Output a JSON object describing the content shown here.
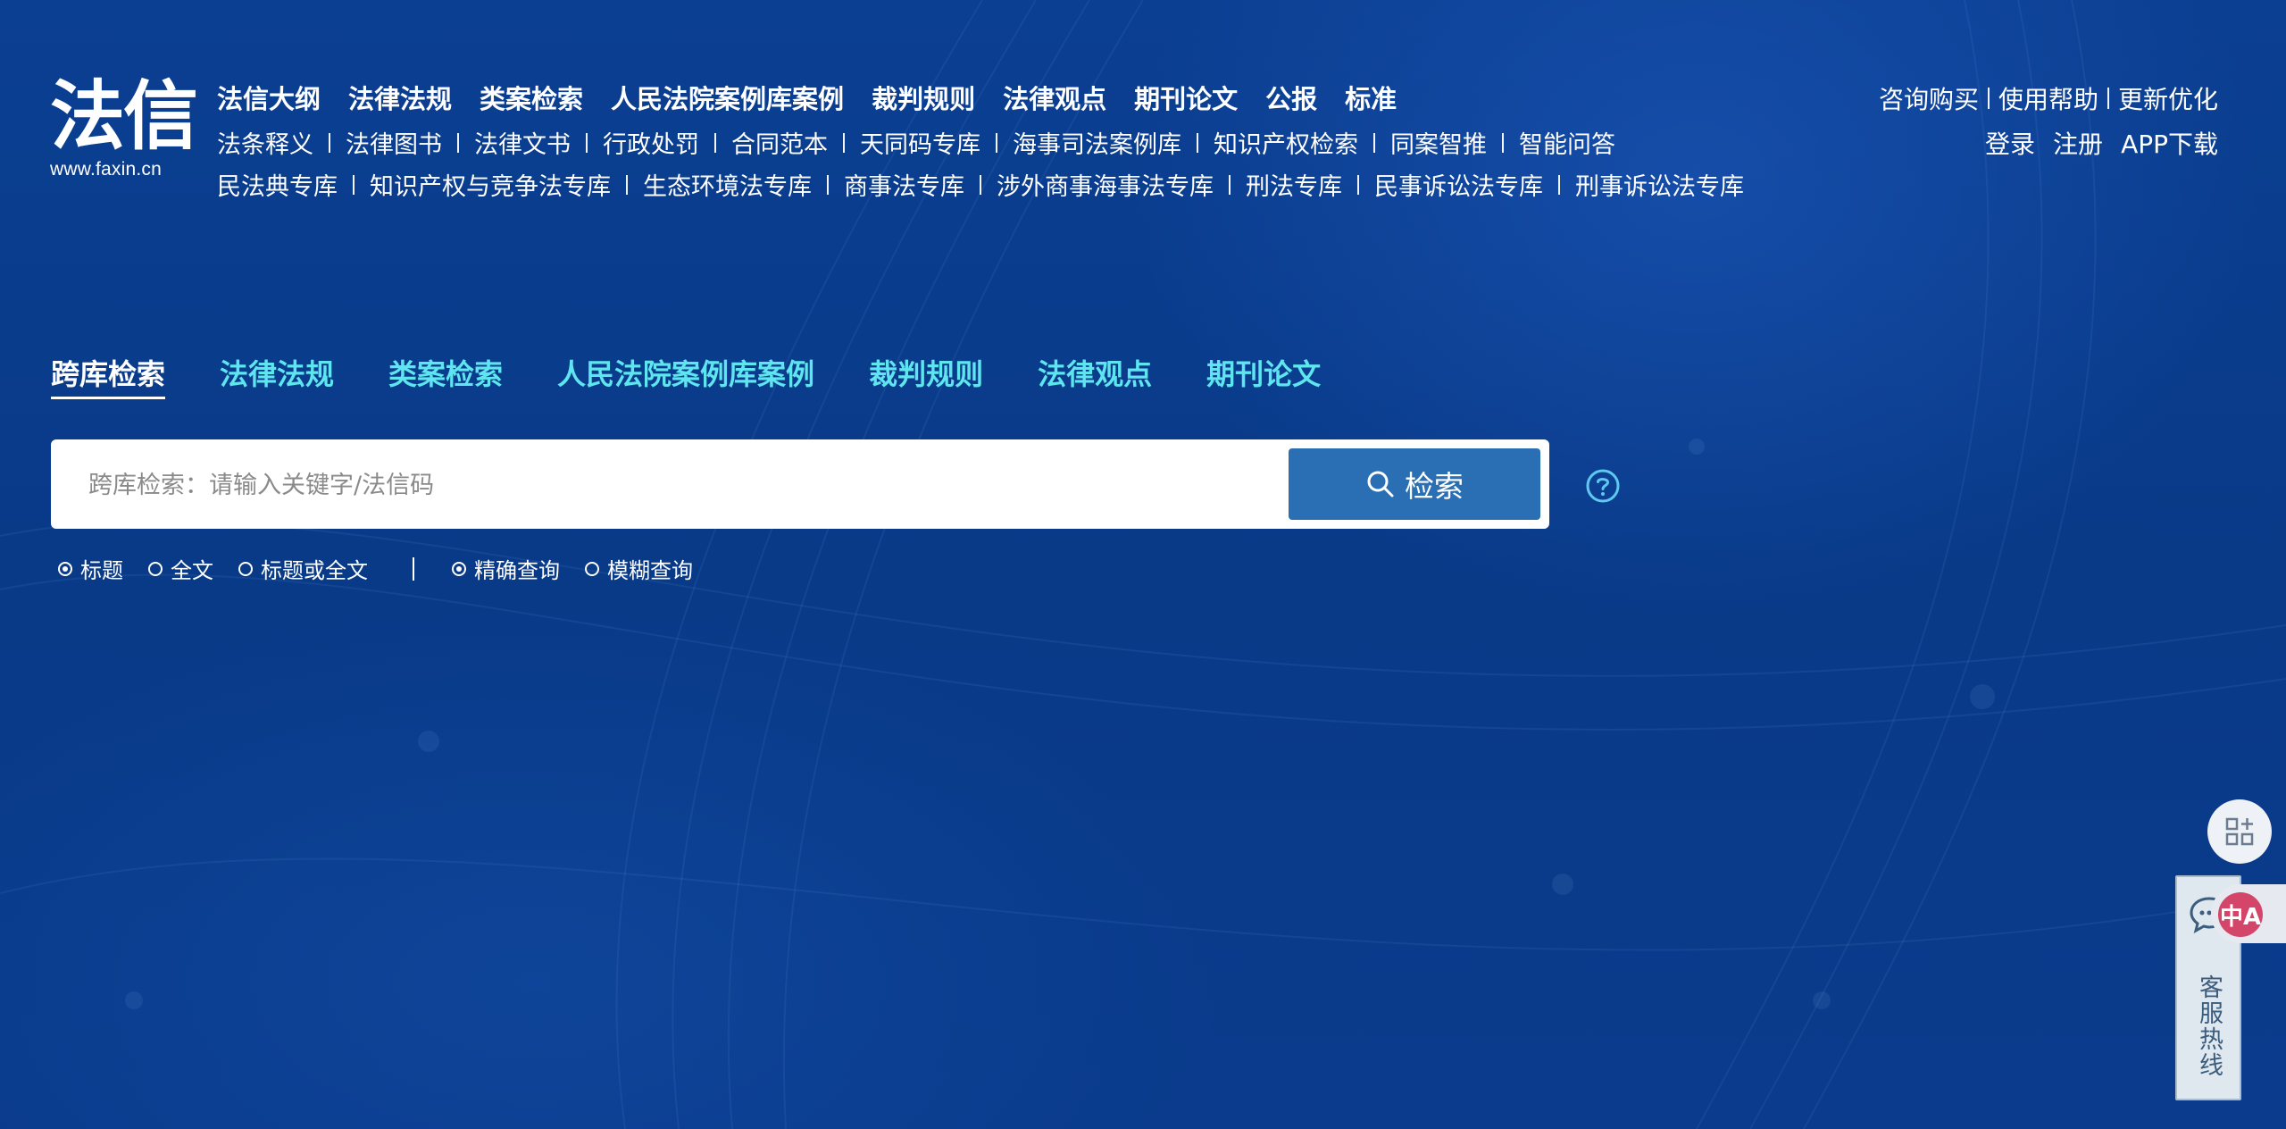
{
  "logo": {
    "main": "法信",
    "url": "www.faxin.cn"
  },
  "nav": {
    "row1": [
      "法信大纲",
      "法律法规",
      "类案检索",
      "人民法院案例库案例",
      "裁判规则",
      "法律观点",
      "期刊论文",
      "公报",
      "标准"
    ],
    "row2": [
      "法条释义",
      "法律图书",
      "法律文书",
      "行政处罚",
      "合同范本",
      "天同码专库",
      "海事司法案例库",
      "知识产权检索",
      "同案智推",
      "智能问答"
    ],
    "row3": [
      "民法典专库",
      "知识产权与竞争法专库",
      "生态环境法专库",
      "商事法专库",
      "涉外商事海事法专库",
      "刑法专库",
      "民事诉讼法专库",
      "刑事诉讼法专库"
    ]
  },
  "top_right": {
    "row1": [
      "咨询购买",
      "使用帮助",
      "更新优化"
    ],
    "row2": [
      "登录",
      "注册",
      "APP下载"
    ]
  },
  "tabs": [
    "跨库检索",
    "法律法规",
    "类案检索",
    "人民法院案例库案例",
    "裁判规则",
    "法律观点",
    "期刊论文"
  ],
  "active_tab": "跨库检索",
  "search": {
    "placeholder": "跨库检索：请输入关键字/法信码",
    "value": "",
    "button_label": "检索"
  },
  "options": {
    "scope": [
      {
        "label": "标题",
        "checked": true
      },
      {
        "label": "全文",
        "checked": false
      },
      {
        "label": "标题或全文",
        "checked": false
      }
    ],
    "mode": [
      {
        "label": "精确查询",
        "checked": true
      },
      {
        "label": "模糊查询",
        "checked": false
      }
    ]
  },
  "hotline": {
    "label": "客服热线"
  },
  "translate_badge": {
    "label": "中A"
  },
  "icons": {
    "search": "search-icon",
    "help": "help-icon",
    "apps": "apps-grid-icon",
    "chat": "chat-icon"
  },
  "colors": {
    "background": "#0a3a8a",
    "tab_inactive": "#5ee5ef",
    "search_button": "#2a6fb4",
    "badge": "#d4456a"
  }
}
